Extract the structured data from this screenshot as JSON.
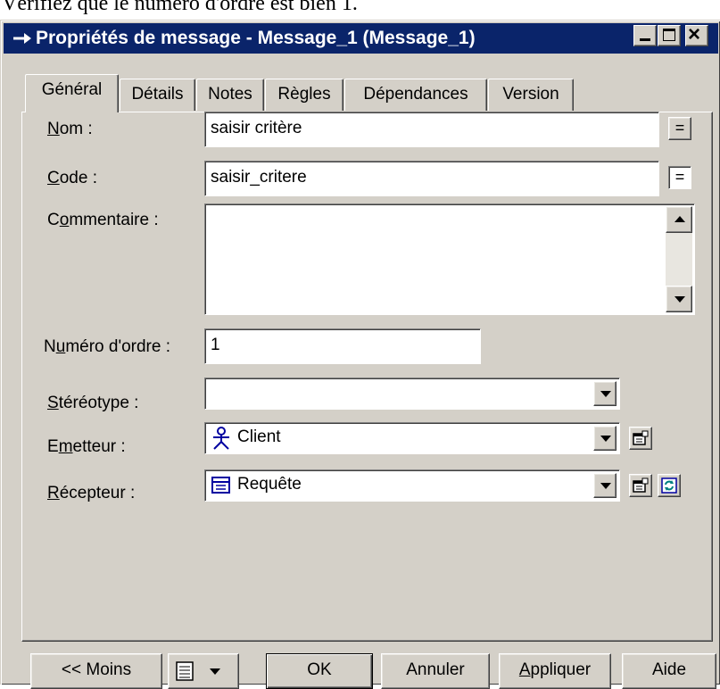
{
  "background_text": "Vérifiez que le numéro d'ordre est bien 1.",
  "window": {
    "title": "Propriétés de message - Message_1 (Message_1)",
    "controls": {
      "minimize": "_",
      "maximize": "□",
      "close": "×"
    }
  },
  "tabs": [
    {
      "label": "Général",
      "active": true
    },
    {
      "label": "Détails"
    },
    {
      "label": "Notes"
    },
    {
      "label": "Règles"
    },
    {
      "label": "Dépendances"
    },
    {
      "label": "Version"
    }
  ],
  "form": {
    "nom": {
      "label_u": "N",
      "label_rest": "om :",
      "value": "saisir critère",
      "button": "="
    },
    "code": {
      "label_u": "C",
      "label_rest": "ode :",
      "value": "saisir_critere",
      "button": "="
    },
    "commentaire": {
      "label_pre": "C",
      "label_u": "o",
      "label_rest": "mmentaire :",
      "value": ""
    },
    "numero": {
      "label_pre": "N",
      "label_u": "u",
      "label_rest": "méro d'ordre :",
      "value": "1"
    },
    "stereotype": {
      "label_u": "S",
      "label_rest": "téréotype :",
      "value": ""
    },
    "emetteur": {
      "label_pre": "E",
      "label_u": "m",
      "label_rest": "etteur :",
      "value": "Client",
      "icon": "actor-icon"
    },
    "recepteur": {
      "label_u": "R",
      "label_rest": "écepteur :",
      "value": "Requête",
      "icon": "object-icon"
    }
  },
  "buttons": {
    "moins": "<< Moins",
    "ok": "OK",
    "annuler": "Annuler",
    "appliquer_u": "A",
    "appliquer_rest": "ppliquer",
    "aide": "Aide"
  },
  "colors": {
    "face": "#d4d0c8",
    "titlebar": "#0a246a",
    "icon_blue": "#0000a0"
  }
}
